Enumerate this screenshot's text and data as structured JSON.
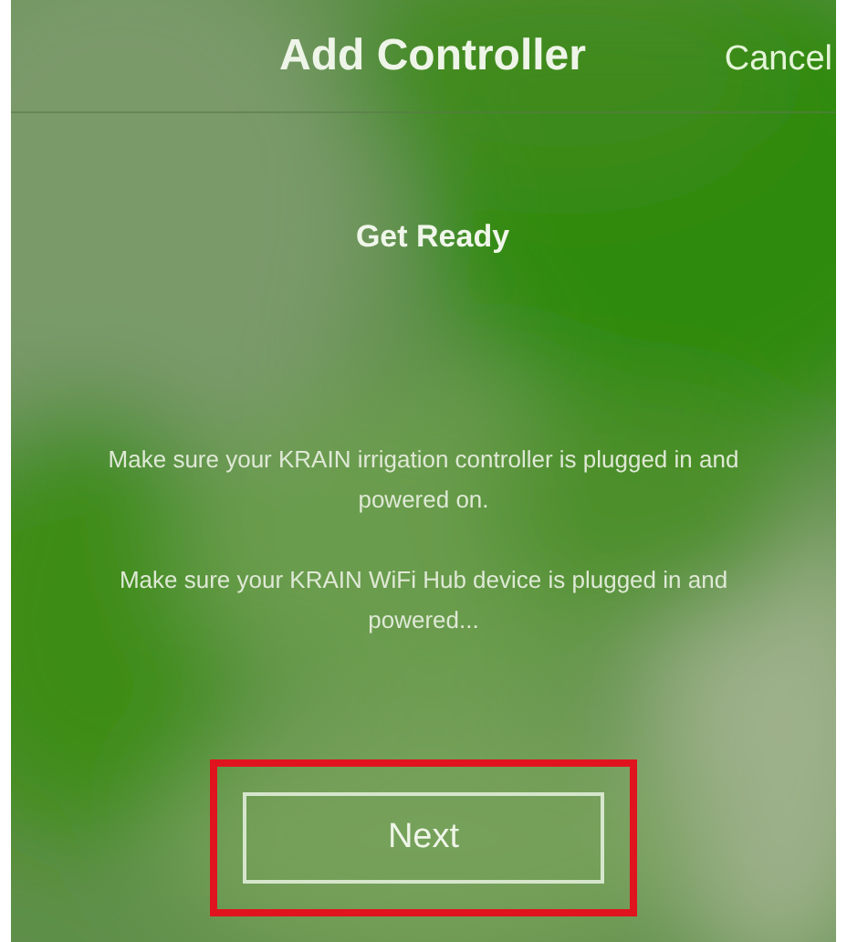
{
  "header": {
    "title": "Add Controller",
    "cancel": "Cancel"
  },
  "heading": "Get Ready",
  "instructions": [
    "Make sure your KRAIN irrigation controller is plugged in and powered on.",
    "Make sure your KRAIN WiFi Hub device is plugged in and powered..."
  ],
  "next_button": {
    "label": "Next",
    "highlighted": true
  }
}
